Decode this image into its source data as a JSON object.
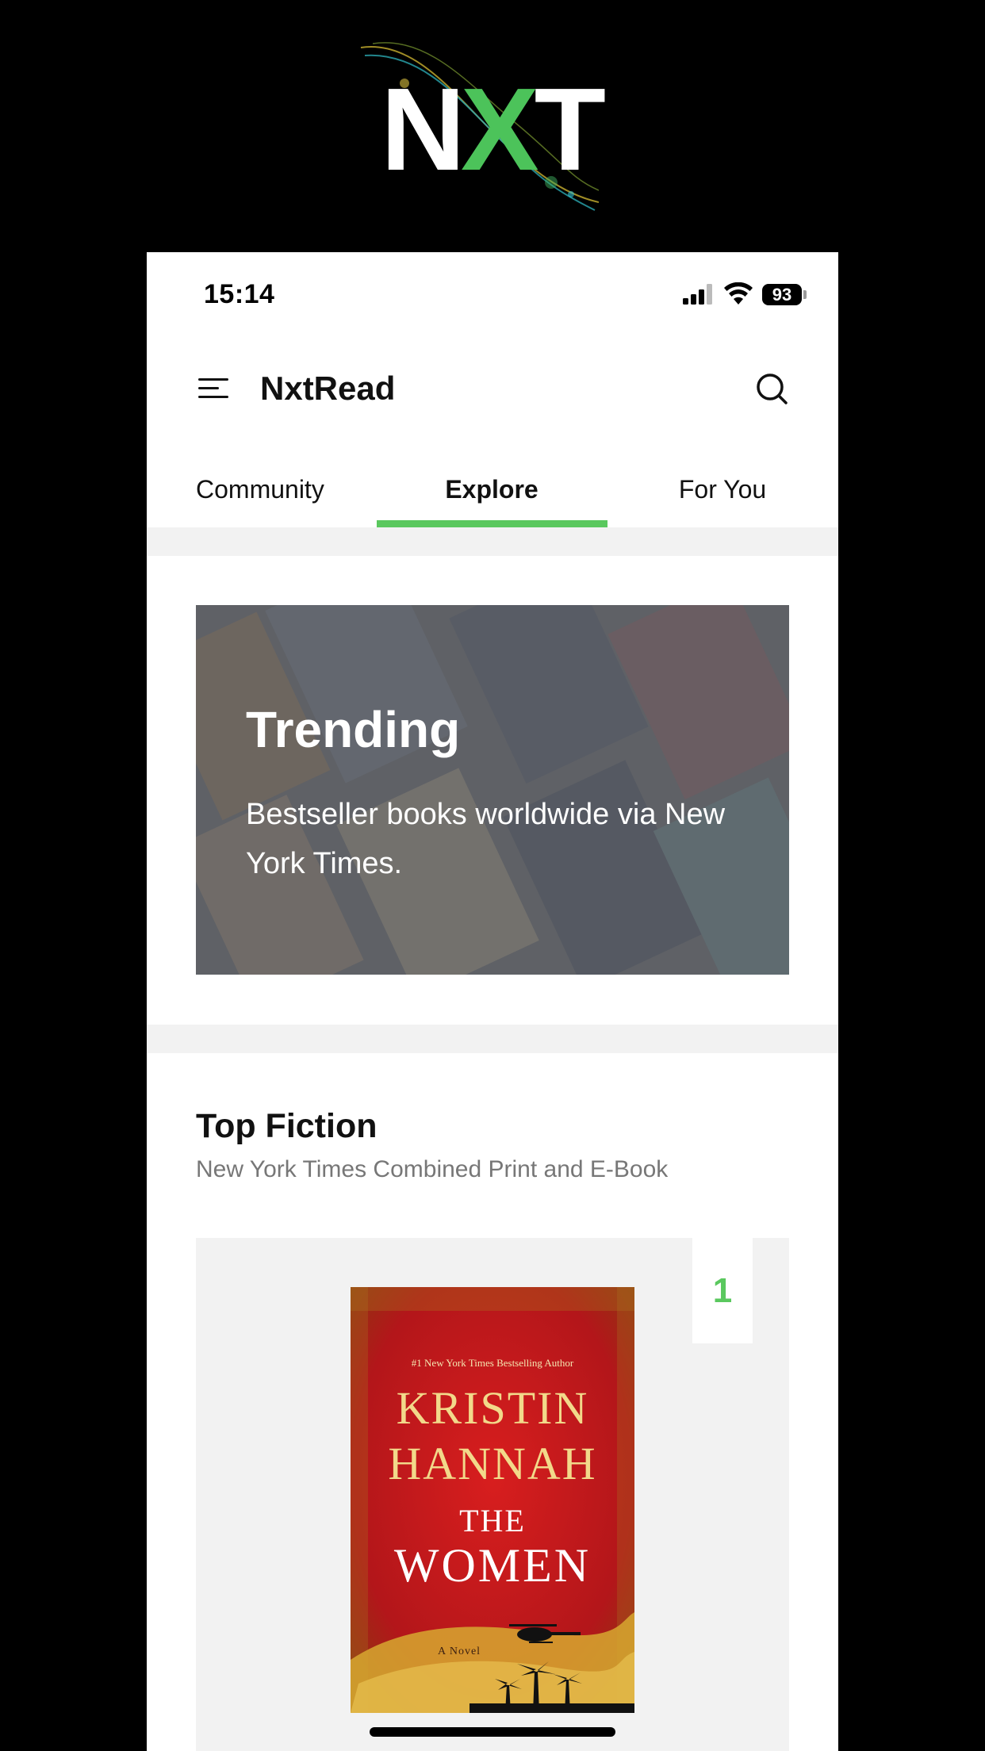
{
  "logo": {
    "text_n": "N",
    "text_x": "X",
    "text_t": "T",
    "brand_color": "#4cc35a"
  },
  "status_bar": {
    "time": "15:14",
    "battery": "93"
  },
  "app_bar": {
    "title": "NxtRead"
  },
  "tabs": [
    {
      "label": "Community",
      "selected": false
    },
    {
      "label": "Explore",
      "selected": true
    },
    {
      "label": "For You",
      "selected": false
    }
  ],
  "accent_color": "#5ac85e",
  "trending_banner": {
    "title": "Trending",
    "description": "Bestseller books worldwide via New York Times."
  },
  "top_fiction": {
    "title": "Top Fiction",
    "subtitle": "New York Times Combined Print and E-Book",
    "books": [
      {
        "rank": "1",
        "cover": {
          "tagline": "#1 New York Times Bestselling Author",
          "author_line1": "KRISTIN",
          "author_line2": "HANNAH",
          "title_line1": "THE",
          "title_line2": "WOMEN",
          "format": "A Novel"
        }
      }
    ]
  }
}
